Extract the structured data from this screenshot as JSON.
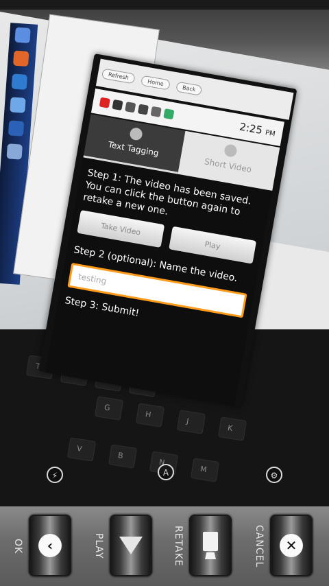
{
  "preview": {
    "browser_toolbar": [
      "Refresh",
      "Home",
      "Back"
    ],
    "clock": "2:25",
    "clock_suffix": "PM",
    "tabs": [
      {
        "label": "Text Tagging"
      },
      {
        "label": "Short Video"
      }
    ],
    "step1": "Step 1: The video has been saved. You can click the button again to retake a new one.",
    "take_video_label": "Take Video",
    "play_label": "Play",
    "step2": "Step 2 (optional): Name the video.",
    "name_value": "testing",
    "step3": "Step 3: Submit!",
    "keyboard_letters": [
      "G",
      "H",
      "J",
      "K",
      "V",
      "B",
      "N",
      "M",
      "T",
      "Y",
      "U",
      "I"
    ]
  },
  "controls": {
    "ok_label": "OK",
    "play_label": "PLAY",
    "retake_label": "RETAKE",
    "cancel_label": "CANCEL",
    "ok_icon": "chevron-left-icon",
    "play_icon": "play-triangle-icon",
    "retake_icon": "camera-retake-icon",
    "cancel_icon": "close-circle-icon"
  },
  "colors": {
    "accent_orange": "#ff9a1a",
    "bar_gray": "#6d6d6d"
  }
}
